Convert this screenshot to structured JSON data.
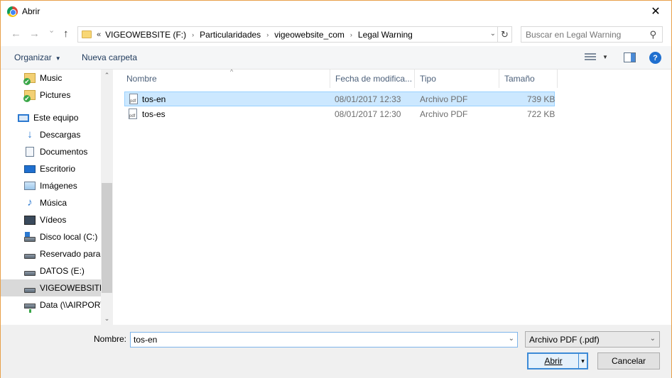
{
  "window": {
    "title": "Abrir",
    "close_glyph": "✕"
  },
  "nav_buttons": {
    "back": "←",
    "forward": "→",
    "recent": "⌄",
    "up": "↑"
  },
  "address": {
    "overflow": "«",
    "crumbs": [
      "VIGEOWEBSITE (F:)",
      "Particularidades",
      "vigeowebsite_com",
      "Legal Warning"
    ],
    "separator": "›",
    "dropdown_glyph": "⌄",
    "refresh_glyph": "↻"
  },
  "search": {
    "placeholder": "Buscar en Legal Warning",
    "icon_glyph": "⚲"
  },
  "toolbar": {
    "organize": "Organizar",
    "organize_caret": "▼",
    "new_folder": "Nueva carpeta",
    "view_caret": "▼",
    "help": "?"
  },
  "nav_pane": {
    "items": [
      {
        "label": "Music",
        "icon": "library-folder-icon"
      },
      {
        "label": "Pictures",
        "icon": "library-folder-icon"
      },
      {
        "label": "Este equipo",
        "icon": "computer-icon"
      },
      {
        "label": "Descargas",
        "icon": "download-icon"
      },
      {
        "label": "Documentos",
        "icon": "document-icon"
      },
      {
        "label": "Escritorio",
        "icon": "desktop-icon"
      },
      {
        "label": "Imágenes",
        "icon": "image-icon"
      },
      {
        "label": "Música",
        "icon": "music-icon"
      },
      {
        "label": "Vídeos",
        "icon": "video-icon"
      },
      {
        "label": "Disco local (C:)",
        "icon": "windows-drive-icon"
      },
      {
        "label": "Reservado para el sistema",
        "icon": "drive-icon"
      },
      {
        "label": "DATOS (E:)",
        "icon": "drive-icon"
      },
      {
        "label": "VIGEOWEBSITE (F:)",
        "icon": "drive-icon"
      },
      {
        "label": "Data (\\\\AIRPORT)",
        "icon": "network-drive-icon"
      }
    ],
    "scroll_up": "⌃",
    "scroll_down": "⌄"
  },
  "file_list": {
    "columns": [
      "Nombre",
      "Fecha de modifica...",
      "Tipo",
      "Tamaño"
    ],
    "sort_glyph": "^",
    "rows": [
      {
        "name": "tos-en",
        "modified": "08/01/2017 12:33",
        "type": "Archivo PDF",
        "size": "739 KB"
      },
      {
        "name": "tos-es",
        "modified": "08/01/2017 12:30",
        "type": "Archivo PDF",
        "size": "722 KB"
      }
    ]
  },
  "footer": {
    "name_label": "Nombre:",
    "name_value": "tos-en",
    "name_dropdown": "⌄",
    "filter": "Archivo PDF (.pdf)",
    "filter_dropdown": "⌄",
    "open": "Abrir",
    "open_split": "▾",
    "cancel": "Cancelar"
  },
  "colors": {
    "accent": "#cce8ff",
    "accent_border": "#99d1ff",
    "button_focus": "#3c8ad6",
    "window_border": "#e8a04a"
  }
}
